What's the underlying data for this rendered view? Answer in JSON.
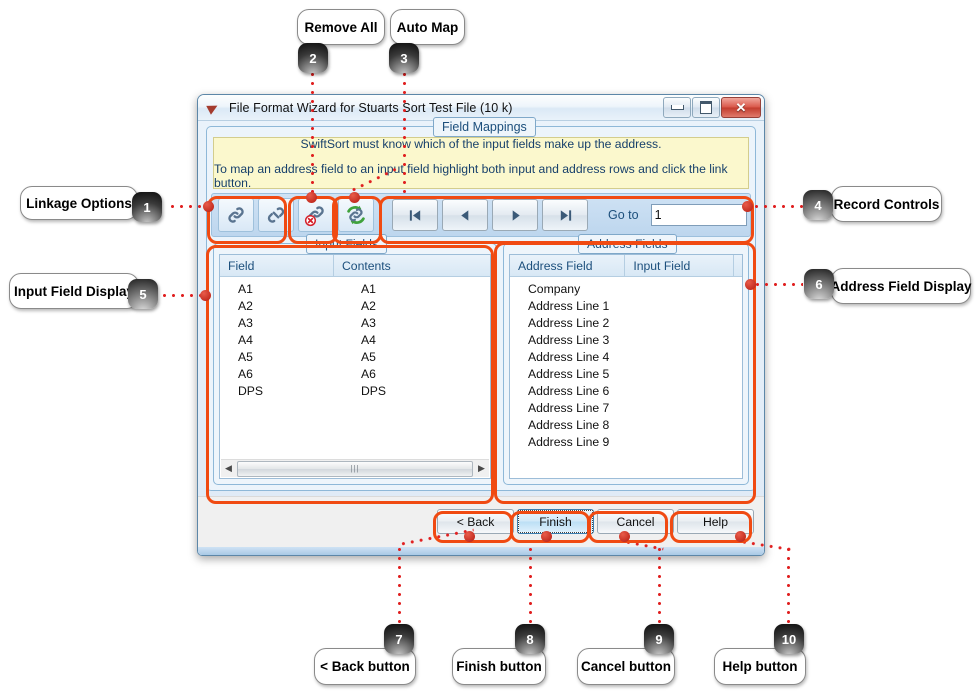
{
  "window": {
    "title": "File Format Wizard for Stuarts Sort Test File  (10 k)",
    "icon": "app-arrow-icon",
    "controls": {
      "minimize": "minimize-icon",
      "maximize": "maximize-icon",
      "close": "✕"
    }
  },
  "group": {
    "legend": "Field Mappings"
  },
  "info": {
    "line1": "SwiftSort must know which of the input fields make up the address.",
    "line2": "To map an address field to an input field highlight both input and address rows and click the link button."
  },
  "toolbar": {
    "link_icon": "link-icon",
    "unlink_icon": "unlink-icon",
    "remove_all_icon": "remove-all-link-icon",
    "auto_map_icon": "auto-map-icon",
    "nav_first": "|◁",
    "nav_prev": "❮",
    "nav_next": "❯",
    "nav_last": "▷|",
    "goto_label": "Go to",
    "goto_value": "1"
  },
  "input_fields": {
    "legend": "Input Fields",
    "columns": [
      "Field",
      "Contents"
    ],
    "rows": [
      [
        "A1",
        "A1"
      ],
      [
        "A2",
        "A2"
      ],
      [
        "A3",
        "A3"
      ],
      [
        "A4",
        "A4"
      ],
      [
        "A5",
        "A5"
      ],
      [
        "A6",
        "A6"
      ],
      [
        "DPS",
        "DPS"
      ]
    ]
  },
  "address_fields": {
    "legend": "Address Fields",
    "columns": [
      "Address Field",
      "Input Field"
    ],
    "rows": [
      [
        "Company",
        ""
      ],
      [
        "Address Line 1",
        ""
      ],
      [
        "Address Line 2",
        ""
      ],
      [
        "Address Line 3",
        ""
      ],
      [
        "Address Line 4",
        ""
      ],
      [
        "Address Line 5",
        ""
      ],
      [
        "Address Line 6",
        ""
      ],
      [
        "Address Line 7",
        ""
      ],
      [
        "Address Line 8",
        ""
      ],
      [
        "Address Line 9",
        ""
      ]
    ]
  },
  "dialog_buttons": {
    "back": "< Back",
    "finish": "Finish",
    "cancel": "Cancel",
    "help": "Help"
  },
  "callouts": [
    {
      "number": "1",
      "label": "Linkage Options"
    },
    {
      "number": "2",
      "label": "Remove All"
    },
    {
      "number": "3",
      "label": "Auto Map"
    },
    {
      "number": "4",
      "label": "Record Controls"
    },
    {
      "number": "5",
      "label": "Input Field Display"
    },
    {
      "number": "6",
      "label": "Address Field Display"
    },
    {
      "number": "7",
      "label": "< Back button"
    },
    {
      "number": "8",
      "label": "Finish button"
    },
    {
      "number": "9",
      "label": "Cancel button"
    },
    {
      "number": "10",
      "label": "Help button"
    }
  ],
  "colors": {
    "highlight": "#f04a12",
    "connector": "#e02020",
    "info_bg": "#fbf8cd"
  }
}
